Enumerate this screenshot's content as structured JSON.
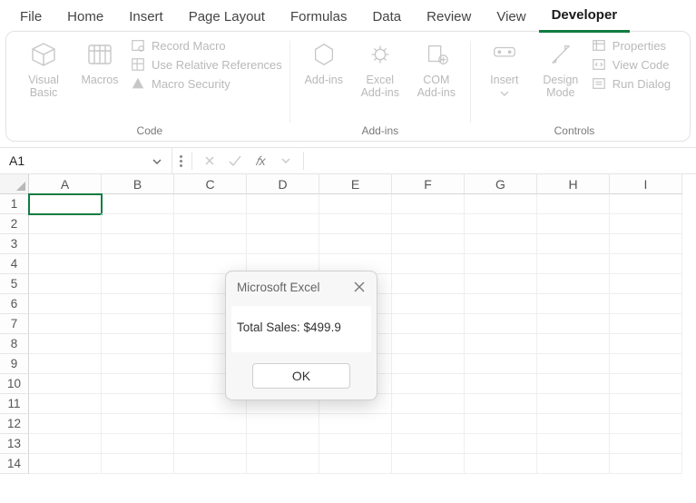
{
  "tabs": {
    "items": [
      "File",
      "Home",
      "Insert",
      "Page Layout",
      "Formulas",
      "Data",
      "Review",
      "View",
      "Developer"
    ],
    "active": "Developer"
  },
  "ribbon": {
    "code": {
      "label": "Code",
      "visual_basic": "Visual Basic",
      "macros": "Macros",
      "record_macro": "Record Macro",
      "use_relative": "Use Relative References",
      "macro_security": "Macro Security"
    },
    "addins": {
      "label": "Add-ins",
      "addins": "Add-ins",
      "excel_addins": "Excel Add-ins",
      "com_addins": "COM Add-ins"
    },
    "controls": {
      "label": "Controls",
      "insert": "Insert",
      "design_mode": "Design Mode",
      "properties": "Properties",
      "view_code": "View Code",
      "run_dialog": "Run Dialog"
    }
  },
  "formula_bar": {
    "name_box": "A1",
    "fx_label": "𝑓x",
    "formula_value": ""
  },
  "grid": {
    "columns": [
      "A",
      "B",
      "C",
      "D",
      "E",
      "F",
      "G",
      "H",
      "I"
    ],
    "rows": [
      "1",
      "2",
      "3",
      "4",
      "5",
      "6",
      "7",
      "8",
      "9",
      "10",
      "11",
      "12",
      "13",
      "14"
    ],
    "selected_cell": "A1"
  },
  "dialog": {
    "title": "Microsoft Excel",
    "message": "Total Sales: $499.9",
    "ok": "OK"
  }
}
